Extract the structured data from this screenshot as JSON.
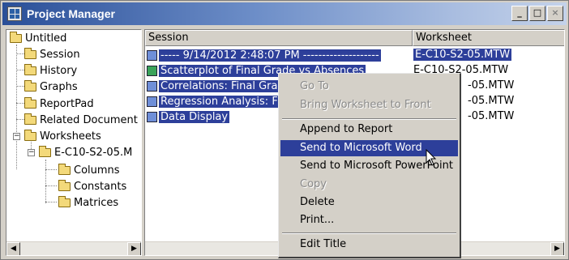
{
  "window": {
    "title": "Project Manager",
    "buttons": {
      "minimize": "_",
      "maximize": "□",
      "close": "×"
    }
  },
  "tree": {
    "items": [
      {
        "label": "Untitled"
      },
      {
        "label": "Session"
      },
      {
        "label": "History"
      },
      {
        "label": "Graphs"
      },
      {
        "label": "ReportPad"
      },
      {
        "label": "Related Document"
      },
      {
        "label": "Worksheets"
      },
      {
        "label": "E-C10-S2-05.M"
      },
      {
        "label": "Columns"
      },
      {
        "label": "Constants"
      },
      {
        "label": "Matrices"
      }
    ],
    "expanders": {
      "worksheets": "−",
      "worksheet": "−"
    },
    "scroll_left": "◀",
    "scroll_right": "▶"
  },
  "session": {
    "columns": {
      "session": "Session",
      "worksheet": "Worksheet"
    },
    "rows": [
      {
        "label": "-----   9/14/2012 2:48:07 PM   --------------------",
        "worksheet": "E-C10-S2-05.MTW",
        "icon": "session-icon"
      },
      {
        "label": "Scatterplot of Final Grade vs Absences",
        "worksheet": "E-C10-S2-05.MTW",
        "icon": "graph-icon"
      },
      {
        "label": "Correlations: Final Grad",
        "worksheet": "-05.MTW",
        "icon": "session-icon"
      },
      {
        "label": "Regression Analysis: Fir",
        "worksheet": "-05.MTW",
        "icon": "session-icon"
      },
      {
        "label": "Data Display",
        "worksheet": "-05.MTW",
        "icon": "session-icon"
      }
    ],
    "scroll_right": "▶"
  },
  "context_menu": {
    "items": [
      {
        "label": "Go To",
        "state": "disabled"
      },
      {
        "label": "Bring Worksheet to Front",
        "state": "disabled"
      },
      {
        "label": "Append to Report",
        "state": "enabled"
      },
      {
        "label": "Send to Microsoft Word",
        "state": "highlighted"
      },
      {
        "label": "Send to Microsoft PowerPoint",
        "state": "enabled"
      },
      {
        "label": "Copy",
        "state": "disabled"
      },
      {
        "label": "Delete",
        "state": "enabled"
      },
      {
        "label": "Print...",
        "state": "enabled"
      },
      {
        "label": "Edit Title",
        "state": "enabled"
      }
    ]
  },
  "colors": {
    "selection": "#2d3f9a",
    "titlebar_start": "#2a4f98",
    "titlebar_end": "#c4d2ea",
    "face": "#d4d0c8"
  }
}
